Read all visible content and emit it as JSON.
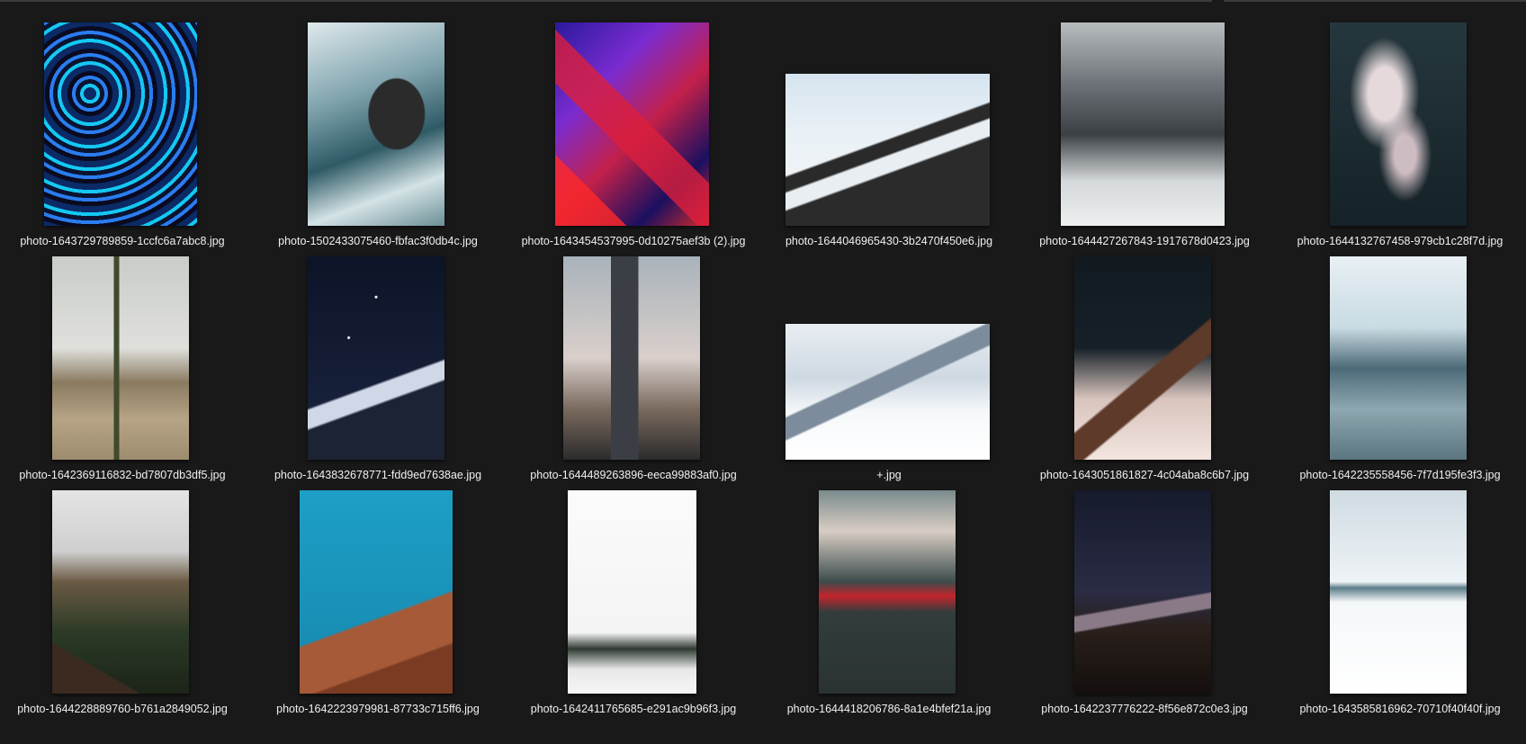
{
  "files": [
    {
      "name": "photo-1643729789859-1ccfc6a7abc8.jpg",
      "thumb": "swirl"
    },
    {
      "name": "photo-1502433075460-fbfac3f0db4c.jpg",
      "thumb": "waves"
    },
    {
      "name": "photo-1643454537995-0d10275aef3b (2).jpg",
      "thumb": "foil"
    },
    {
      "name": "photo-1644046965430-3b2470f450e6.jpg",
      "thumb": "mountain1"
    },
    {
      "name": "photo-1644427267843-1917678d0423.jpg",
      "thumb": "mountain2"
    },
    {
      "name": "photo-1644132767458-979cb1c28f7d.jpg",
      "thumb": "smoke"
    },
    {
      "name": "photo-1642369116832-bd7807db3df5.jpg",
      "thumb": "desert"
    },
    {
      "name": "photo-1643832678771-fdd9ed7638ae.jpg",
      "thumb": "stars"
    },
    {
      "name": "photo-1644489263896-eeca99883af0.jpg",
      "thumb": "building"
    },
    {
      "name": "+.jpg",
      "thumb": "hiker"
    },
    {
      "name": "photo-1643051861827-4c04aba8c6b7.jpg",
      "thumb": "peak"
    },
    {
      "name": "photo-1642235558456-7f7d195fe3f3.jpg",
      "thumb": "frost"
    },
    {
      "name": "photo-1644228889760-b761a2849052.jpg",
      "thumb": "cabin"
    },
    {
      "name": "photo-1642223979981-87733c715ff6.jpg",
      "thumb": "cliff"
    },
    {
      "name": "photo-1642411765685-e291ac9b96f3.jpg",
      "thumb": "trees"
    },
    {
      "name": "photo-1644418206786-8a1e4bfef21a.jpg",
      "thumb": "blur"
    },
    {
      "name": "photo-1642237776222-8f56e872c0e3.jpg",
      "thumb": "volcano"
    },
    {
      "name": "photo-1643585816962-70710f40f40f.jpg",
      "thumb": "snowrock"
    }
  ]
}
